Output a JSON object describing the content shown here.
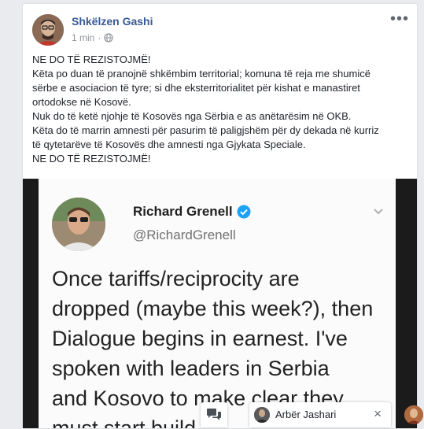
{
  "post": {
    "author": "Shkëlzen Gashi",
    "time": "1 min",
    "time_separator": "·",
    "more_icon": "more-horizontal-icon",
    "lines": [
      "NE DO TË REZISTOJMË!",
      "Këta po duan të pranojnë shkëmbim territorial; komuna të reja me shumicë",
      "sërbe e asociacion të tyre; si dhe eksterritorialitet për kishat e manastiret",
      "ortodokse në Kosovë.",
      "Nuk do të ketë njohje të Kosovës nga Sërbia e as anëtarësim në OKB.",
      "Këta do të marrin amnesti për pasurim të paligjshëm për dy dekada në kurriz",
      "të qytetarëve të Kosovës dhe amnesti nga Gjykata Speciale.",
      "NE DO TË REZISTOJMË!"
    ]
  },
  "tweet": {
    "name": "Richard Grenell",
    "handle": "@RichardGrenell",
    "lines": [
      "Once tariffs/reciprocity are",
      "dropped (maybe this week?), then",
      "Dialogue begins in earnest. I've",
      "spoken with leaders in Serbia",
      "and Kosovo to make clear they",
      "must start build"
    ]
  },
  "chat": {
    "contact_name": "Arbër Jashari",
    "close_symbol": "×"
  },
  "colors": {
    "author_link": "#385898",
    "page_bg": "#e9ebee",
    "verified": "#1da1f2"
  }
}
